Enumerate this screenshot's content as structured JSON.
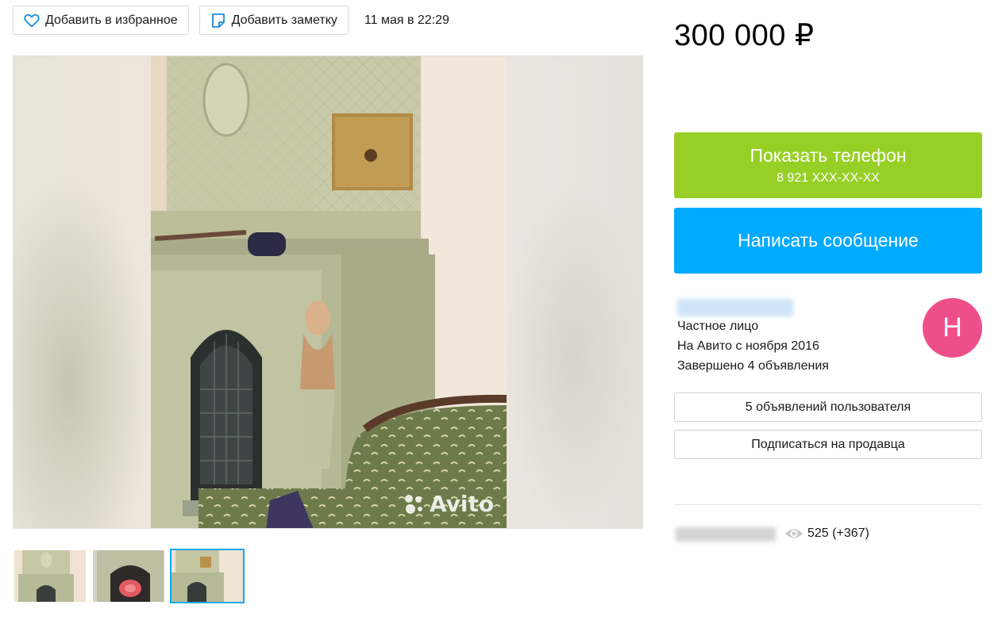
{
  "toolbar": {
    "favorite_label": "Добавить в избранное",
    "favorite_icon": "heart-icon",
    "note_label": "Добавить заметку",
    "note_icon": "note-icon",
    "date": "11 мая в 22:29"
  },
  "gallery": {
    "watermark": "Avito",
    "thumbnails_count": 3,
    "active_thumbnail": 3
  },
  "listing": {
    "price": "300 000 ₽"
  },
  "contact": {
    "phone_button_label": "Показать телефон",
    "phone_masked": "8 921 XXX-XX-XX",
    "message_button_label": "Написать сообщение"
  },
  "seller": {
    "type": "Частное лицо",
    "since": "На Авито с ноября 2016",
    "completed": "Завершено 4 объявления",
    "avatar_letter": "Н",
    "avatar_color": "#ee4f8a",
    "ads_button_label": "5 объявлений пользователя",
    "subscribe_button_label": "Подписаться на продавца"
  },
  "stats": {
    "views": "525 (+367)",
    "views_icon": "eye-icon"
  },
  "colors": {
    "phone_button": "#97cf26",
    "message_button": "#00aaff",
    "accent_link": "#00aaff"
  }
}
